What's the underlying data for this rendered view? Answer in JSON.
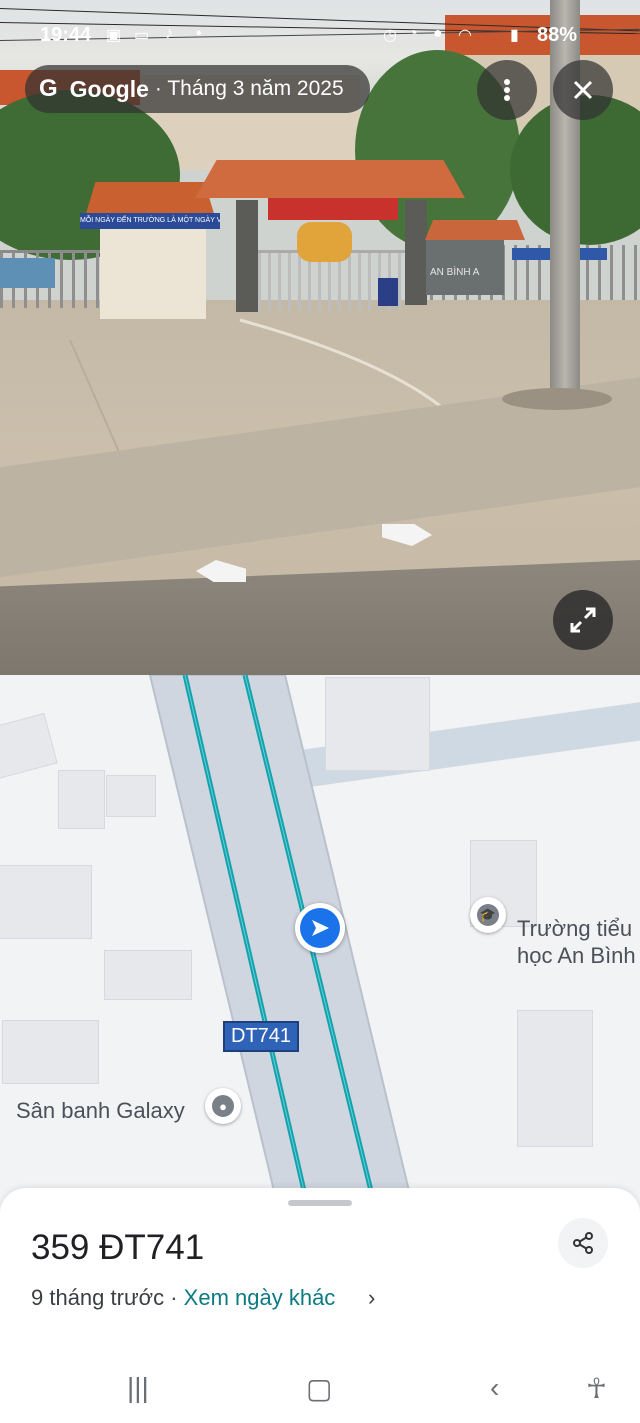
{
  "status_bar": {
    "time": "19:44",
    "battery": "88%"
  },
  "streetview": {
    "brand": "Google",
    "date": "· Tháng 3 năm 2025",
    "photo_signs": {
      "left_booth_banner": "MỖI NGÀY ĐẾN TRƯỜNG LÀ MỘT NGÀY VUI",
      "school_name_sign": "AN BÌNH A"
    }
  },
  "map": {
    "road_shield": "DT741",
    "place_school": "Trường tiểu học An Bình",
    "place_galaxy": "Sân banh Galaxy"
  },
  "sheet": {
    "address": "359 ĐT741",
    "captured": "9 tháng trước ·",
    "other_dates_link": "Xem ngày khác"
  },
  "icons": [
    "more-vert-icon",
    "close-icon",
    "expand-icon",
    "share-icon",
    "school-icon",
    "pin-icon",
    "navigation-arrow-icon",
    "chevron-right-icon",
    "recent-apps-icon",
    "home-icon",
    "back-icon",
    "accessibility-icon"
  ],
  "colors": {
    "route": "#13a3ad",
    "position": "#1a73e8",
    "link": "#0b7a83",
    "shield": "#2f63b8"
  }
}
